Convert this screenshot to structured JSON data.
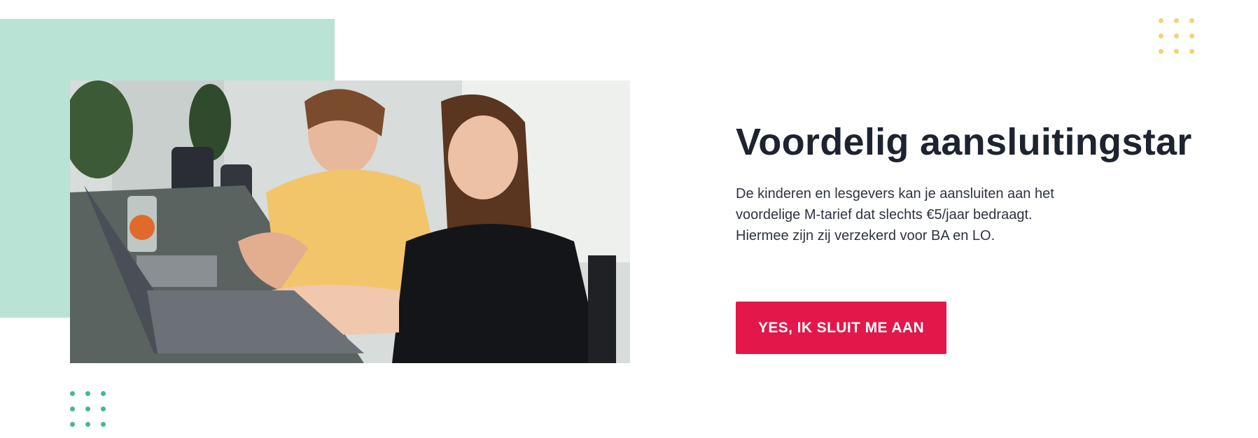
{
  "section": {
    "heading": "Voordelig aansluitingstar",
    "body_lines": [
      "De kinderen en lesgevers kan je aansluiten aan het",
      "voordelige M-tarief dat slechts €5/jaar bedraagt.",
      "Hiermee zijn zij verzekerd voor BA en LO."
    ],
    "cta_label": "YES, IK SLUIT ME AAN"
  },
  "image": {
    "subject": "two-women-at-laptop-photo"
  },
  "colors": {
    "accent": "#e3174a",
    "mint": "#b9e3d4",
    "dots_yellow": "#f6cf7b",
    "dots_green": "#47b594",
    "heading": "#1e2330"
  }
}
